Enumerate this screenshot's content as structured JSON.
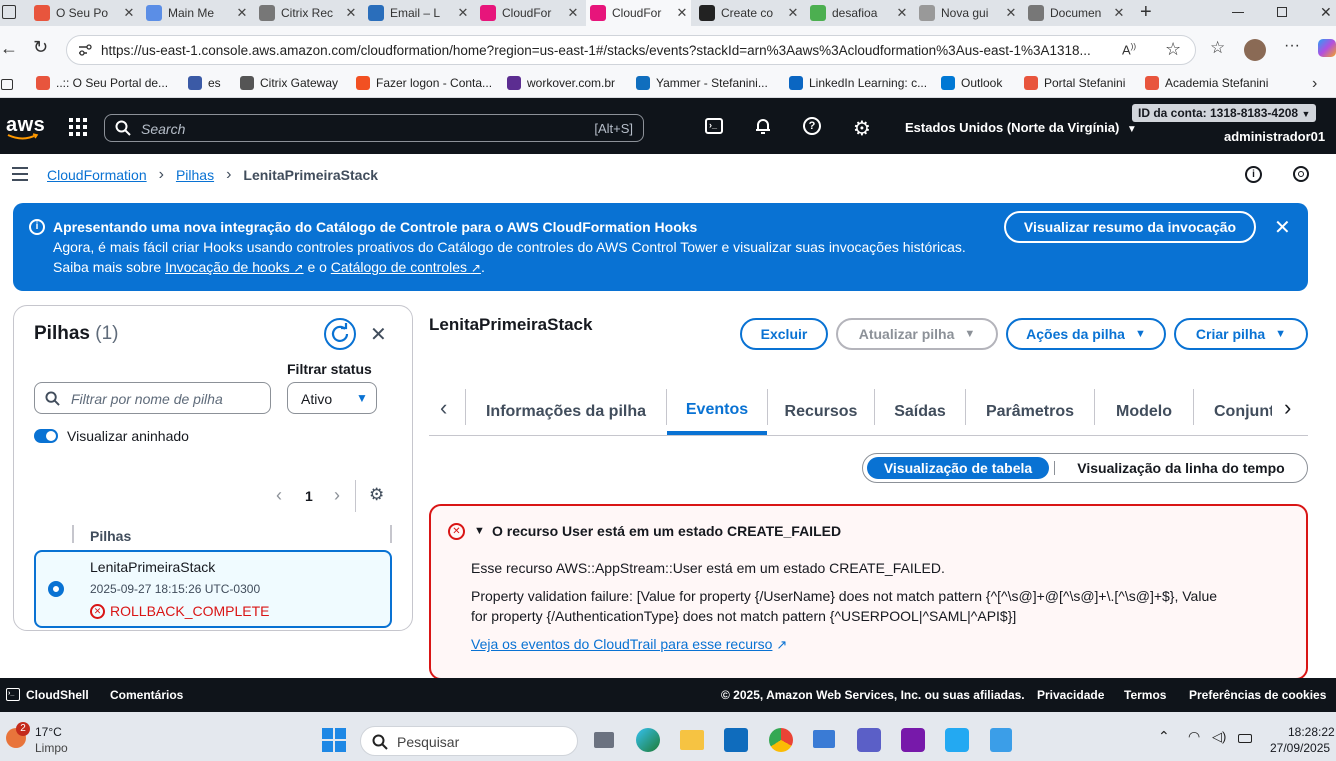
{
  "browser": {
    "tabs": [
      {
        "title": "O Seu Po",
        "color": "#e8553d"
      },
      {
        "title": "Main Me",
        "color": "#5b8ee6"
      },
      {
        "title": "Citrix Rec",
        "color": "#777777"
      },
      {
        "title": "Email – L",
        "color": "#2a6ebb"
      },
      {
        "title": "CloudFor",
        "color": "#e7157b"
      },
      {
        "title": "CloudFor",
        "color": "#e7157b"
      },
      {
        "title": "Create co",
        "color": "#222222"
      },
      {
        "title": "desafioa",
        "color": "#4caf50"
      },
      {
        "title": "Nova gui",
        "color": "#999999"
      },
      {
        "title": "Documen",
        "color": "#777777"
      }
    ],
    "tab_close": "✕",
    "url": "https://us-east-1.console.aws.amazon.com/cloudformation/home?region=us-east-1#/stacks/events?stackId=arn%3Aaws%3Acloudformation%3Aus-east-1%3A1318...",
    "bookmarks": [
      {
        "label": "..:: O Seu Portal de...",
        "color": "#e8553d"
      },
      {
        "label": "es",
        "color": "#3b5aa6"
      },
      {
        "label": "Citrix Gateway",
        "color": "#555555"
      },
      {
        "label": "Fazer logon - Conta...",
        "color": "#f25022"
      },
      {
        "label": "workover.com.br",
        "color": "#5c2d91"
      },
      {
        "label": "Yammer - Stefanini...",
        "color": "#106ebe"
      },
      {
        "label": "LinkedIn Learning: c...",
        "color": "#0a66c2"
      },
      {
        "label": "Outlook",
        "color": "#0078d4"
      },
      {
        "label": "Portal Stefanini",
        "color": "#e8553d"
      },
      {
        "label": "Academia Stefanini",
        "color": "#e8553d"
      }
    ]
  },
  "aws": {
    "logo": "aws",
    "search_placeholder": "Search",
    "search_shortcut": "[Alt+S]",
    "region": "Estados Unidos (Norte da Virgínia)",
    "account_id": "ID da conta: 1318-8183-4208",
    "user": "administrador01"
  },
  "breadcrumb": {
    "items": [
      "CloudFormation",
      "Pilhas",
      "LenitaPrimeiraStack"
    ]
  },
  "banner": {
    "title": "Apresentando uma nova integração do Catálogo de Controle para o AWS CloudFormation Hooks",
    "line1": "Agora, é mais fácil criar Hooks usando controles proativos do Catálogo de controles do AWS Control Tower e visualizar suas invocações históricas.",
    "line2_prefix": "Saiba mais sobre",
    "link1": "Invocação de hooks",
    "line2_mid": "e o",
    "link2": "Catálogo de controles",
    "line2_suffix": ".",
    "button": "Visualizar resumo da invocação"
  },
  "stacks_panel": {
    "title": "Pilhas",
    "count": "(1)",
    "filter_placeholder": "Filtrar por nome de pilha",
    "filter_status_label": "Filtrar status",
    "filter_status_value": "Ativo",
    "nested_toggle_label": "Visualizar aninhado",
    "page": "1",
    "column_header": "Pilhas",
    "stack": {
      "name": "LenitaPrimeiraStack",
      "date": "2025-09-27 18:15:26 UTC-0300",
      "status": "ROLLBACK_COMPLETE"
    }
  },
  "detail": {
    "title": "LenitaPrimeiraStack",
    "buttons": {
      "delete": "Excluir",
      "update": "Atualizar pilha",
      "actions": "Ações da pilha",
      "create": "Criar pilha"
    },
    "tabs": [
      "Informações da pilha",
      "Eventos",
      "Recursos",
      "Saídas",
      "Parâmetros",
      "Modelo",
      "Conjunt"
    ],
    "view_toggle": {
      "table": "Visualização de tabela",
      "timeline": "Visualização da linha do tempo"
    },
    "error": {
      "title": "O recurso User está em um estado CREATE_FAILED",
      "line1": "Esse recurso AWS::AppStream::User está em um estado CREATE_FAILED.",
      "line2": "Property validation failure: [Value for property {/UserName} does not match pattern {^[^\\s@]+@[^\\s@]+\\.[^\\s@]+$}, Value",
      "line3": "for property {/AuthenticationType} does not match pattern {^USERPOOL|^SAML|^API$}]",
      "link": "Veja os eventos do CloudTrail para esse recurso"
    }
  },
  "footer": {
    "cloudshell": "CloudShell",
    "comments": "Comentários",
    "copyright": "© 2025, Amazon Web Services, Inc. ou suas afiliadas.",
    "privacy": "Privacidade",
    "terms": "Termos",
    "cookies": "Preferências de cookies"
  },
  "taskbar": {
    "weather_badge": "2",
    "temperature": "17°C",
    "weather": "Limpo",
    "search_placeholder": "Pesquisar",
    "time": "18:28:22",
    "date": "27/09/2025"
  },
  "colors": {
    "aws_nav": "#0f141a",
    "primary_blue": "#0972d3",
    "error_red": "#d91515"
  }
}
